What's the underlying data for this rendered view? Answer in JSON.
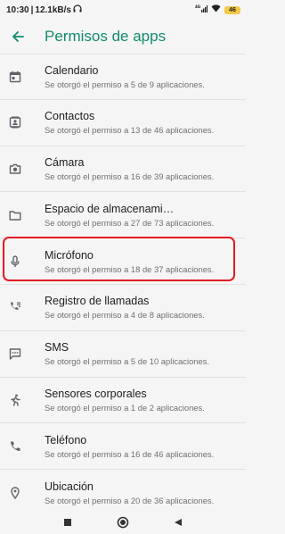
{
  "status_bar": {
    "time": "10:30",
    "speed": "12.1kB/s",
    "network": "4G",
    "battery": "46"
  },
  "app_bar": {
    "title": "Permisos de apps",
    "back_icon": "arrow-back-icon"
  },
  "permissions": [
    {
      "title": "Calendario",
      "subtitle": "Se otorgó el permiso a 5 de 9 aplicaciones.",
      "icon": "calendar-icon"
    },
    {
      "title": "Contactos",
      "subtitle": "Se otorgó el permiso a 13 de 46 aplicaciones.",
      "icon": "contacts-icon"
    },
    {
      "title": "Cámara",
      "subtitle": "Se otorgó el permiso a 16 de 39 aplicaciones.",
      "icon": "camera-icon"
    },
    {
      "title": "Espacio de almacenami…",
      "subtitle": "Se otorgó el permiso a 27 de 73 aplicaciones.",
      "icon": "folder-icon"
    },
    {
      "title": "Micrófono",
      "subtitle": "Se otorgó el permiso a 18 de 37 aplicaciones.",
      "icon": "microphone-icon"
    },
    {
      "title": "Registro de llamadas",
      "subtitle": "Se otorgó el permiso a 4 de 8 aplicaciones.",
      "icon": "call-log-icon"
    },
    {
      "title": "SMS",
      "subtitle": "Se otorgó el permiso a 5 de 10 aplicaciones.",
      "icon": "sms-icon"
    },
    {
      "title": "Sensores corporales",
      "subtitle": "Se otorgó el permiso a 1 de 2 aplicaciones.",
      "icon": "body-sensors-icon"
    },
    {
      "title": "Teléfono",
      "subtitle": "Se otorgó el permiso a 16 de 46 aplicaciones.",
      "icon": "phone-icon"
    },
    {
      "title": "Ubicación",
      "subtitle": "Se otorgó el permiso a 20 de 36 aplicaciones.",
      "icon": "location-icon"
    }
  ],
  "colors": {
    "accent": "#138a6f",
    "highlight": "#e31b23",
    "icon": "#5f6368"
  }
}
